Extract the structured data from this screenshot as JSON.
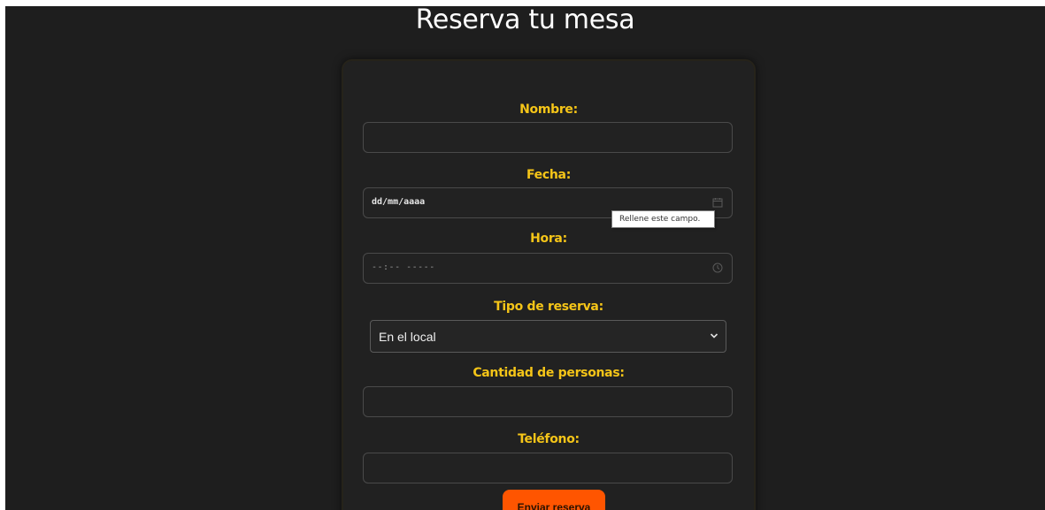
{
  "page": {
    "title": "Reserva tu mesa"
  },
  "form": {
    "name_label": "Nombre:",
    "name_value": "",
    "date_label": "Fecha:",
    "date_placeholder": "dd/mm/aaaa",
    "time_label": "Hora:",
    "time_placeholder": "--:-- -----",
    "reservation_type_label": "Tipo de reserva:",
    "reservation_type_selected": "En el local",
    "people_label": "Cantidad de personas:",
    "people_value": "",
    "phone_label": "Teléfono:",
    "phone_value": "",
    "submit_label": "Enviar reserva"
  },
  "tooltip": {
    "text": "Rellene este campo."
  },
  "icons": {
    "date_icon": "calendar-icon",
    "time_icon": "clock-icon",
    "select_icon": "chevron-down-icon"
  },
  "colors": {
    "background": "#1e1e1e",
    "label": "#f5c518",
    "button": "#ff5500",
    "title": "#ffffff"
  }
}
